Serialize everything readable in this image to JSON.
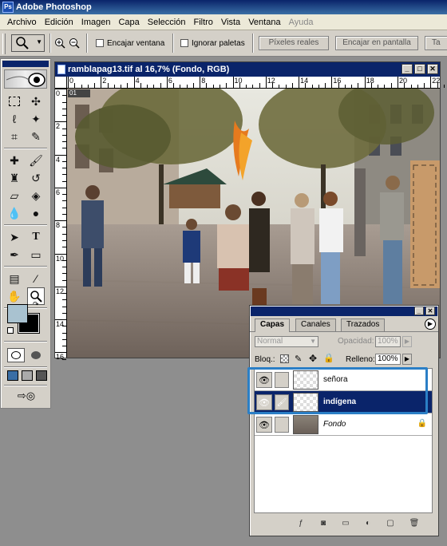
{
  "app": {
    "title": "Adobe Photoshop"
  },
  "menu": [
    "Archivo",
    "Edición",
    "Imagen",
    "Capa",
    "Selección",
    "Filtro",
    "Vista",
    "Ventana",
    "Ayuda"
  ],
  "options": {
    "encajar_ventana": "Encajar ventana",
    "ignorar_paletas": "Ignorar paletas",
    "pixeles_reales": "Píxeles reales",
    "encajar_pantalla": "Encajar en pantalla",
    "tamano_impresion": "Ta"
  },
  "document": {
    "title": "ramblapag13.tif al 16,7% (Fondo, RGB)",
    "ruler_top": [
      "0",
      "2",
      "4",
      "6",
      "8",
      "10",
      "12",
      "14",
      "16",
      "18",
      "20",
      "22"
    ],
    "ruler_left": [
      "0",
      "2",
      "4",
      "6",
      "8",
      "10",
      "12",
      "14",
      "16"
    ],
    "tab_label": "01"
  },
  "layers_panel": {
    "tabs": [
      "Capas",
      "Canales",
      "Trazados"
    ],
    "blend_mode": "Normal",
    "opacity_label": "Opacidad:",
    "opacity_value": "100%",
    "lock_label": "Bloq.:",
    "fill_label": "Relleno:",
    "fill_value": "100%",
    "layers": [
      {
        "name": "señora",
        "selected": false
      },
      {
        "name": "indígena",
        "selected": true
      },
      {
        "name": "Fondo",
        "selected": false
      }
    ]
  },
  "colors": {
    "foreground": "#a9c2d0",
    "background": "#000000",
    "highlight": "#2b7fc6",
    "selection": "#0a246a"
  }
}
